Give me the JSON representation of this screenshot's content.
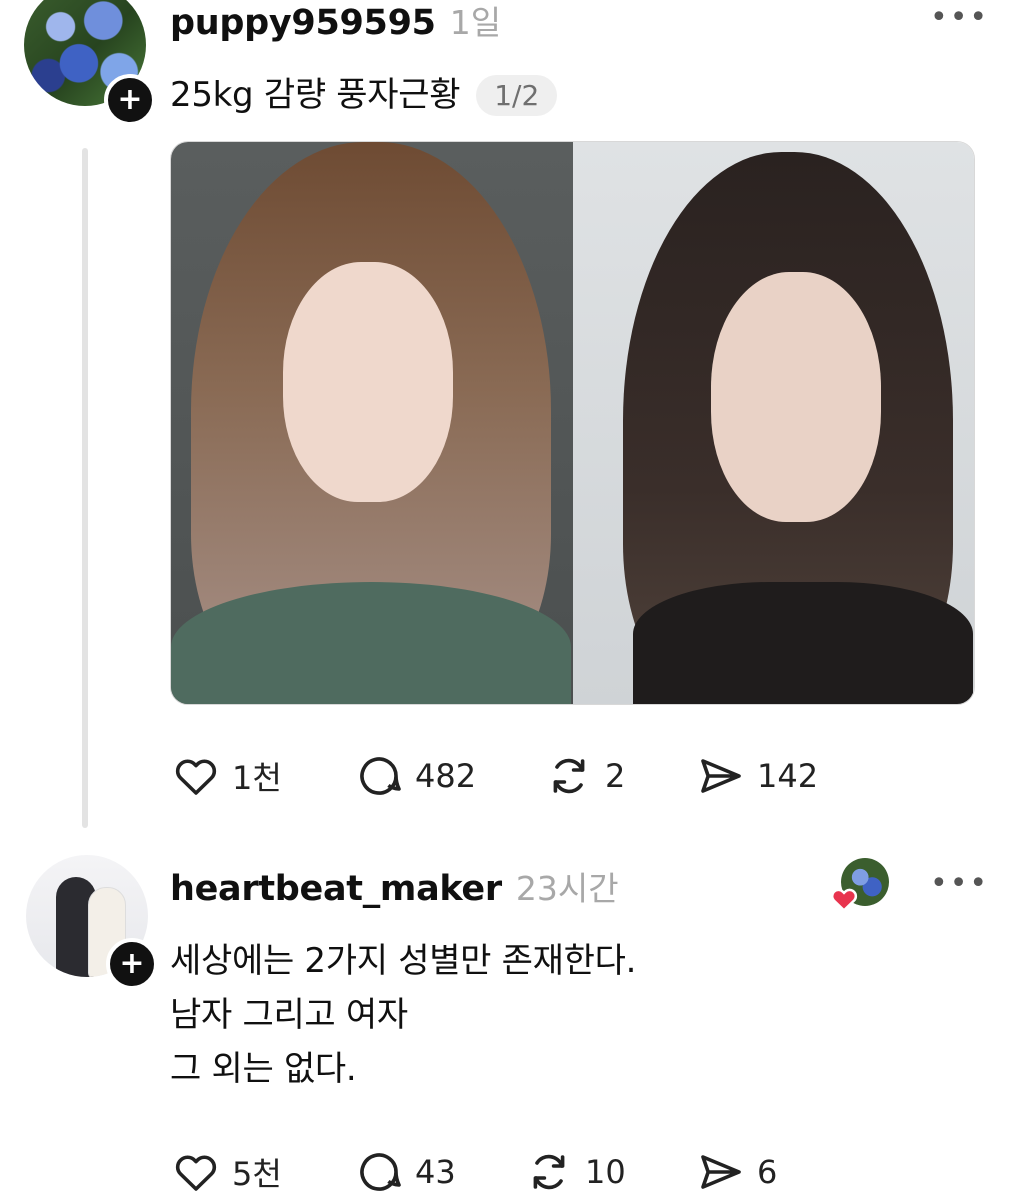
{
  "post": {
    "username": "puppy959595",
    "time": "1일",
    "text": "25kg 감량 풍자근황",
    "page_indicator": "1/2",
    "more_icon": "more-horizontal-icon",
    "stats": {
      "likes": "1천",
      "comments": "482",
      "reposts": "2",
      "shares": "142"
    }
  },
  "reply": {
    "username": "heartbeat_maker",
    "time": "23시간",
    "lines": [
      "세상에는 2가지 성별만 존재한다.",
      "남자 그리고 여자",
      "그 외는 없다."
    ],
    "more_icon": "more-horizontal-icon",
    "stats": {
      "likes": "5천",
      "comments": "43",
      "reposts": "10",
      "shares": "6"
    }
  },
  "icons": {
    "like": "heart-icon",
    "comment": "comment-bubble-icon",
    "repost": "repost-icon",
    "share": "send-icon",
    "follow": "plus-icon"
  },
  "colors": {
    "text": "#101010",
    "muted": "#a8a8a8",
    "badge": "#111111",
    "liked": "#e8344e"
  }
}
